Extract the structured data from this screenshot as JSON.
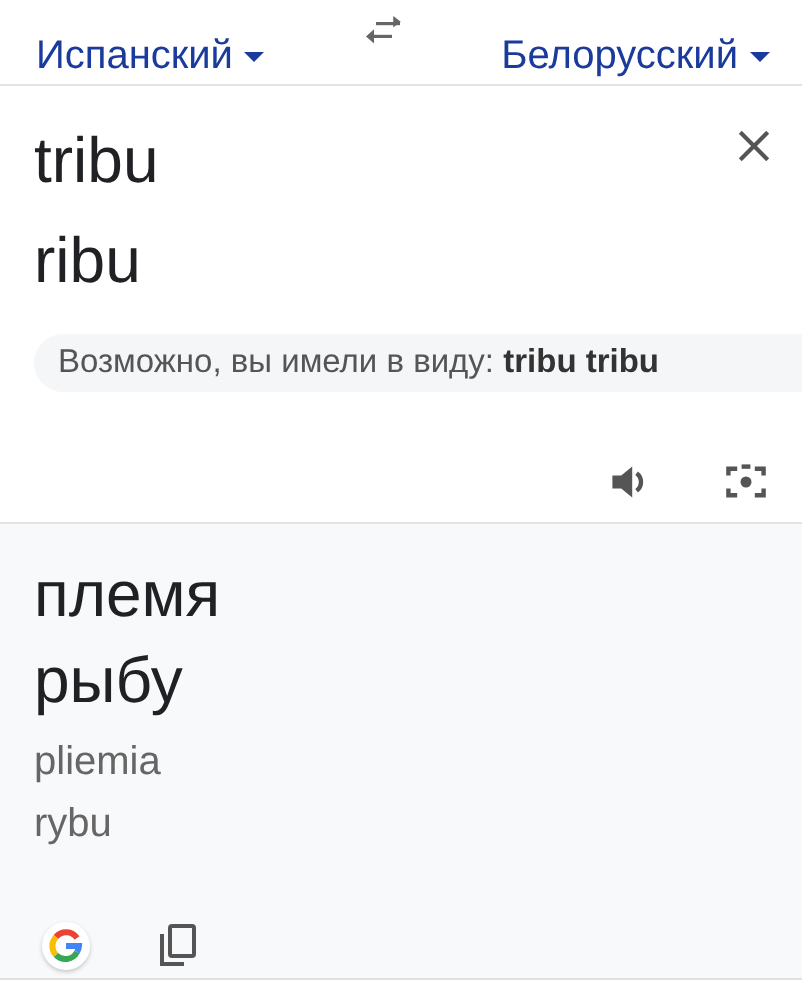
{
  "languages": {
    "source": "Испанский",
    "target": "Белорусский"
  },
  "source": {
    "lines": [
      "tribu",
      "ribu"
    ],
    "suggestion": "Возможно, вы имели в виду: **tribu tribu**"
  },
  "translation": {
    "lines": [
      "племя",
      "рыбу"
    ],
    "transliteration": [
      "pliemia",
      "rybu"
    ]
  }
}
